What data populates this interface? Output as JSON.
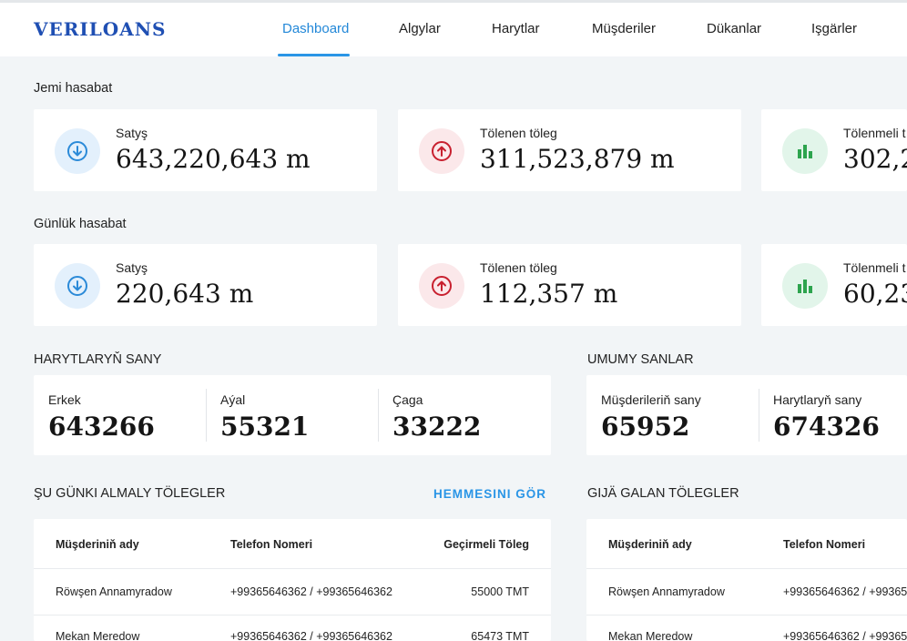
{
  "app": {
    "logo": "VERILOANS"
  },
  "nav": {
    "items": [
      {
        "label": "Dashboard",
        "active": true
      },
      {
        "label": "Algylar"
      },
      {
        "label": "Harytlar"
      },
      {
        "label": "Müşderiler"
      },
      {
        "label": "Dükanlar"
      },
      {
        "label": "Işgärler"
      }
    ]
  },
  "total": {
    "title": "Jemi hasabat",
    "cards": [
      {
        "label": "Satyş",
        "value": "643,220,643 m",
        "icon": "arrow-down-circle-icon"
      },
      {
        "label": "Tölenen töleg",
        "value": "311,523,879 m",
        "icon": "arrow-up-circle-icon"
      },
      {
        "label": "Tölenmeli t",
        "value": "302,2",
        "icon": "bar-chart-icon"
      }
    ]
  },
  "daily": {
    "title": "Günlük hasabat",
    "cards": [
      {
        "label": "Satyş",
        "value": "220,643 m",
        "icon": "arrow-down-circle-icon"
      },
      {
        "label": "Tölenen töleg",
        "value": "112,357 m",
        "icon": "arrow-up-circle-icon"
      },
      {
        "label": "Tölenmeli t",
        "value": "60,23",
        "icon": "bar-chart-icon"
      }
    ]
  },
  "card_counts": {
    "title": "HARYTLARYŇ SANY",
    "items": [
      {
        "label": "Erkek",
        "value": "643266"
      },
      {
        "label": "Aýal",
        "value": "55321"
      },
      {
        "label": "Çaga",
        "value": "33222"
      }
    ]
  },
  "general": {
    "title": "UMUMY SANLAR",
    "items": [
      {
        "label": "Müşderileriň sany",
        "value": "65952"
      },
      {
        "label": "Harytlaryň sany",
        "value": "674326"
      }
    ]
  },
  "today_payments": {
    "title": "ŞU GÜNKI ALMALY TÖLEGLER",
    "see_all": "HEMMESINI GÖR",
    "headers": [
      "Müşderiniň ady",
      "Telefon Nomeri",
      "Geçirmeli Töleg"
    ],
    "rows": [
      [
        "Röwşen Annamyradow",
        "+99365646362 / +99365646362",
        "55000 TMT"
      ],
      [
        "Mekan Meredow",
        "+99365646362 / +99365646362",
        "65473 TMT"
      ]
    ]
  },
  "overdue_payments": {
    "title": "GIJÄ GALAN TÖLEGLER",
    "headers": [
      "Müşderiniň ady",
      "Telefon Nomeri"
    ],
    "rows": [
      [
        "Röwşen Annamyradow",
        "+99365646362 / +99365"
      ],
      [
        "Mekan Meredow",
        "+99365646362 / +99365"
      ]
    ]
  },
  "colors": {
    "accent": "#2a95e6",
    "logo": "#1f4fb3",
    "icon_blue": "#2b8ad8",
    "icon_red": "#c8202f",
    "icon_green": "#2da44e",
    "background": "#f2f5f7"
  }
}
